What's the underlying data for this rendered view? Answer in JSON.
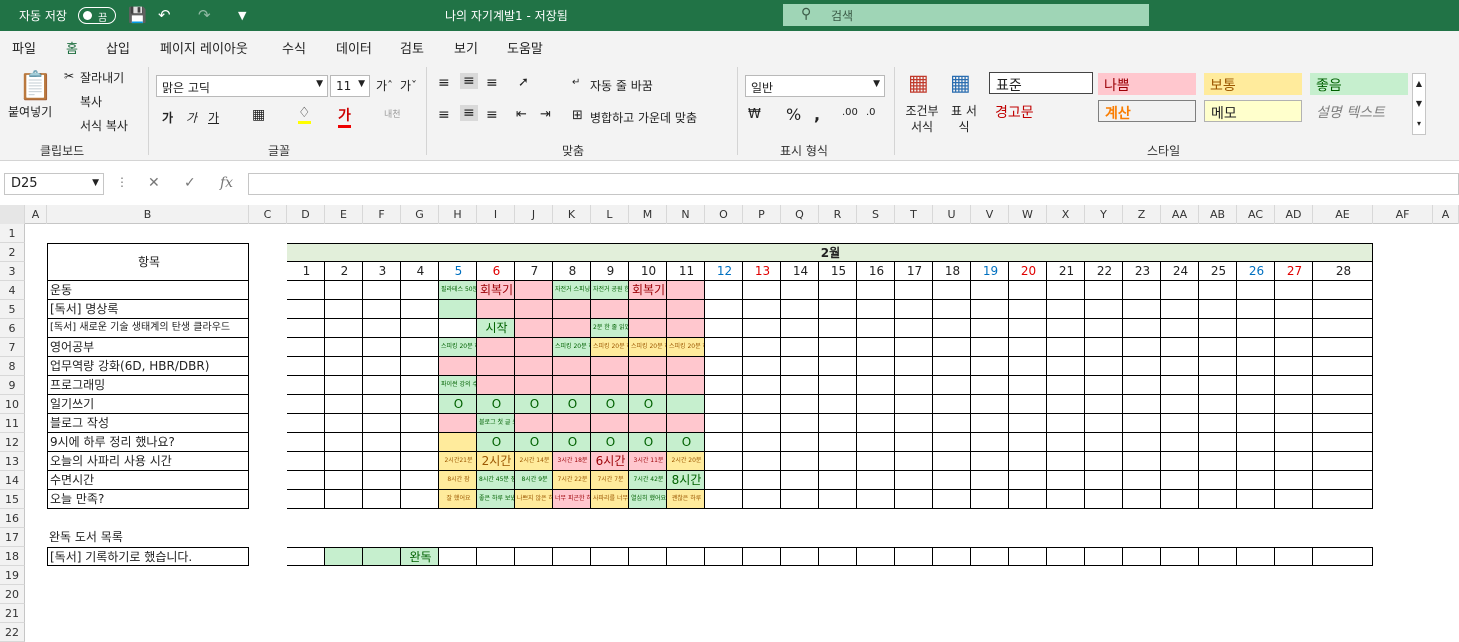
{
  "titlebar": {
    "autosave": "자동 저장",
    "toggle": "끔",
    "title": "나의 자기계발1 - 저장됨",
    "search": "검색"
  },
  "menu": [
    "파일",
    "홈",
    "삽입",
    "페이지 레이아웃",
    "수식",
    "데이터",
    "검토",
    "보기",
    "도움말"
  ],
  "ribbon": {
    "paste": "붙여넣기",
    "cut": "잘라내기",
    "copy": "복사",
    "format_painter": "서식 복사",
    "g_clipboard": "클립보드",
    "font_name": "맑은 고딕",
    "font_size": "11",
    "bold": "가",
    "italic": "가",
    "underline": "가",
    "g_font": "글꼴",
    "wrap": "자동 줄 바꿈",
    "merge": "병합하고 가운데 맞춤",
    "g_align": "맞춤",
    "num_format": "일반",
    "g_number": "표시 형식",
    "cond_format": "조건부 서식",
    "table_format": "표 서식",
    "styles": {
      "normal": "표준",
      "bad": "나쁨",
      "neutral": "보통",
      "good": "좋음",
      "warning": "경고문",
      "calc": "계산",
      "note": "메모",
      "explanatory": "설명 텍스트"
    },
    "g_styles": "스타일"
  },
  "namebox": "D25",
  "col_letters": [
    "A",
    "B",
    "C",
    "D",
    "E",
    "F",
    "G",
    "H",
    "I",
    "J",
    "K",
    "L",
    "M",
    "N",
    "O",
    "P",
    "Q",
    "R",
    "S",
    "T",
    "U",
    "V",
    "W",
    "X",
    "Y",
    "Z",
    "AA",
    "AB",
    "AC",
    "AD",
    "AE",
    "AF",
    "A"
  ],
  "row_numbers": [
    "1",
    "2",
    "3",
    "4",
    "5",
    "6",
    "7",
    "8",
    "9",
    "10",
    "11",
    "12",
    "13",
    "14",
    "15",
    "16",
    "17",
    "18",
    "19",
    "20",
    "21",
    "22"
  ],
  "sheet": {
    "header_item": "항목",
    "month": "2월",
    "days": [
      "1",
      "2",
      "3",
      "4",
      "5",
      "6",
      "7",
      "8",
      "9",
      "10",
      "11",
      "12",
      "13",
      "14",
      "15",
      "16",
      "17",
      "18",
      "19",
      "20",
      "21",
      "22",
      "23",
      "24",
      "25",
      "26",
      "27",
      "28"
    ],
    "weekend_blue": [
      "5",
      "12",
      "19",
      "26"
    ],
    "weekend_red": [
      "6",
      "13",
      "20",
      "27"
    ],
    "rows": [
      "운동",
      "[독서] 명상록",
      "[독서] 새로운 기술 생태계의 탄생 클라우드",
      "영어공부",
      "업무역량 강화(6D, HBR/DBR)",
      "프로그래밍",
      "일기쓰기",
      "블로그 작성",
      "9시에 하루 정리 했나요?",
      "오늘의 사파리 사용 시간",
      "수면시간",
      "오늘 만족?"
    ],
    "cells": {
      "4-5": "필라테스 50분",
      "4-6": "회복기",
      "4-8": "자전거 스피닝 1시간",
      "4-9": "자전거 공원 한 바퀴",
      "4-10": "회복기",
      "6-6": "시작",
      "6-9": "2분 한 줄 읽었어요",
      "7-5": "스피킹 20분 하기",
      "7-8": "스피킹 20분 하기",
      "7-9": "스피킹 20분 하기",
      "7-10": "스피킹 20분 하기",
      "7-11": "스피킹 20분 하기",
      "9-5": "파이썬 강의 수강",
      "10-5": "O",
      "10-6": "O",
      "10-7": "O",
      "10-8": "O",
      "10-9": "O",
      "10-10": "O",
      "11-6": "블로그 첫 글 쓰기 준비",
      "12-6": "O",
      "12-7": "O",
      "12-8": "O",
      "12-9": "O",
      "12-10": "O",
      "12-11": "O",
      "13-5": "2시간21분",
      "13-6": "2시간",
      "13-7": "2시간 14분",
      "13-8": "3시간 18분",
      "13-9": "6시간",
      "13-10": "3시간 11분",
      "13-11": "2시간 20분",
      "14-5": "8시간 잠",
      "14-6": "8시간 45분 잠",
      "14-7": "8시간 9분",
      "14-8": "7시간 22분",
      "14-9": "7시간 7분",
      "14-10": "7시간 42분",
      "14-11": "8시간",
      "15-5": "잘 했어요",
      "15-6": "좋은 하루 보냈어요",
      "15-7": "나쁘지 않은 하루",
      "15-8": "너무 피곤한 하루",
      "15-9": "사파리를 너무 오래 봤어요",
      "15-10": "열심히 했어요",
      "15-11": "괜찮은 하루"
    },
    "fills": {
      "4": {
        "5": "#c6efce",
        "6": "#ffc7ce",
        "7": "#ffc7ce",
        "8": "#c6efce",
        "9": "#c6efce",
        "10": "#ffc7ce",
        "11": "#ffc7ce"
      },
      "5": {
        "5": "#c6efce",
        "6": "#ffc7ce",
        "7": "#ffc7ce",
        "8": "#ffc7ce",
        "9": "#ffc7ce",
        "10": "#ffc7ce",
        "11": "#ffc7ce"
      },
      "6": {
        "6": "#c6efce",
        "7": "#ffc7ce",
        "8": "#ffc7ce",
        "9": "#c6efce",
        "10": "#ffc7ce",
        "11": "#ffc7ce"
      },
      "7": {
        "5": "#c6efce",
        "6": "#ffc7ce",
        "7": "#ffc7ce",
        "8": "#c6efce",
        "9": "#ffeb9c",
        "10": "#ffeb9c",
        "11": "#ffeb9c"
      },
      "8": {
        "5": "#ffc7ce",
        "6": "#ffc7ce",
        "7": "#ffc7ce",
        "8": "#ffc7ce",
        "9": "#ffc7ce",
        "10": "#ffc7ce",
        "11": "#ffc7ce"
      },
      "9": {
        "5": "#c6efce",
        "6": "#ffc7ce",
        "7": "#ffc7ce",
        "8": "#ffc7ce",
        "9": "#ffc7ce",
        "10": "#ffc7ce",
        "11": "#ffc7ce"
      },
      "10": {
        "5": "#c6efce",
        "6": "#c6efce",
        "7": "#c6efce",
        "8": "#c6efce",
        "9": "#c6efce",
        "10": "#c6efce",
        "11": "#c6efce"
      },
      "11": {
        "5": "#ffc7ce",
        "6": "#c6efce",
        "7": "#ffc7ce",
        "8": "#ffc7ce",
        "9": "#ffc7ce",
        "10": "#ffc7ce",
        "11": "#ffc7ce"
      },
      "12": {
        "5": "#ffeb9c",
        "6": "#c6efce",
        "7": "#c6efce",
        "8": "#c6efce",
        "9": "#c6efce",
        "10": "#c6efce",
        "11": "#c6efce"
      },
      "13": {
        "5": "#ffeb9c",
        "6": "#ffeb9c",
        "7": "#ffeb9c",
        "8": "#ffc7ce",
        "9": "#ffc7ce",
        "10": "#ffc7ce",
        "11": "#ffeb9c"
      },
      "14": {
        "5": "#ffeb9c",
        "6": "#c6efce",
        "7": "#c6efce",
        "8": "#ffeb9c",
        "9": "#ffeb9c",
        "10": "#c6efce",
        "11": "#c6efce"
      },
      "15": {
        "5": "#ffeb9c",
        "6": "#c6efce",
        "7": "#ffeb9c",
        "8": "#ffc7ce",
        "9": "#ffeb9c",
        "10": "#c6efce",
        "11": "#ffeb9c"
      }
    },
    "done_title": "완독 도서 목록",
    "done_row": "[독서] 기록하기로 했습니다.",
    "done_mark": "완독"
  }
}
